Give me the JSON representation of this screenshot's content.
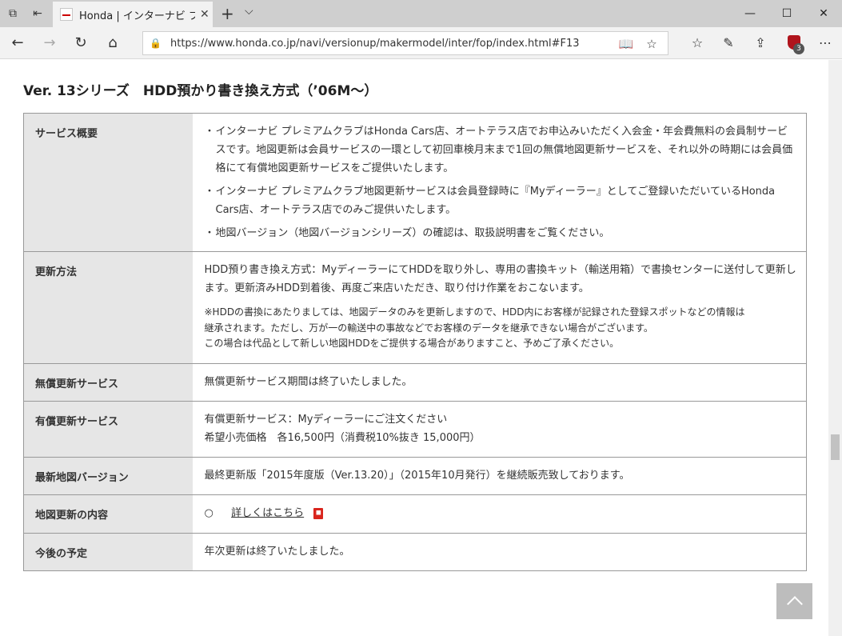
{
  "browser": {
    "tab_title": "Honda | インターナビ プレミ",
    "url": "https://www.honda.co.jp/navi/versionup/makermodel/inter/fop/index.html#F13",
    "extension_count": "3"
  },
  "page": {
    "title": "Ver. 13シリーズ　HDD預かり書き換え方式（’06M～）",
    "rows": [
      {
        "label": "サービス概要",
        "bullets": [
          "インターナビ プレミアムクラブはHonda Cars店、オートテラス店でお申込みいただく入会金・年会費無料の会員制サービスです。地図更新は会員サービスの一環として初回車検月末まで1回の無償地図更新サービスを、それ以外の時期には会員価格にて有償地図更新サービスをご提供いたします。",
          "インターナビ プレミアムクラブ地図更新サービスは会員登録時に『Myディーラー』としてご登録いただいているHonda Cars店、オートテラス店でのみご提供いたします。",
          "地図バージョン（地図バージョンシリーズ）の確認は、取扱説明書をご覧ください。"
        ]
      },
      {
        "label": "更新方法",
        "text": "HDD預り書き換え方式：MyディーラーにてHDDを取り外し、専用の書換キット（輸送用箱）で書換センターに送付して更新します。更新済みHDD到着後、再度ご来店いただき、取り付け作業をおこないます。",
        "note": [
          "※HDDの書換にあたりましては、地図データのみを更新しますので、HDD内にお客様が記録された登録スポットなどの情報は",
          "継承されます。ただし、万が一の輸送中の事故などでお客様のデータを継承できない場合がございます。",
          "この場合は代品として新しい地図HDDをご提供する場合がありますこと、予めご了承ください。"
        ]
      },
      {
        "label": "無償更新サービス",
        "text": "無償更新サービス期間は終了いたしました。"
      },
      {
        "label": "有償更新サービス",
        "line1": "有償更新サービス：Myディーラーにご注文ください",
        "line2": "希望小売価格　各16,500円（消費税10%抜き 15,000円）"
      },
      {
        "label": "最新地図バージョン",
        "text": "最終更新版「2015年度版（Ver.13.20）」（2015年10月発行）を継続販売致しております。"
      },
      {
        "label": "地図更新の内容",
        "marker": "○",
        "link_text": "詳しくはこちら"
      },
      {
        "label": "今後の予定",
        "text": "年次更新は終了いたしました。"
      }
    ]
  }
}
